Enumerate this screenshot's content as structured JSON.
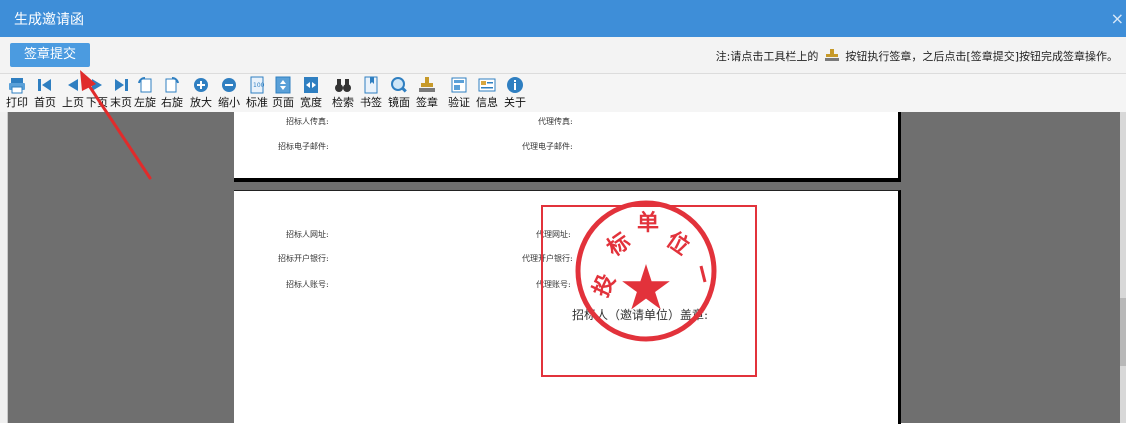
{
  "window": {
    "title": "生成邀请函",
    "close_glyph": "×"
  },
  "actionbar": {
    "sign_submit_label": "签章提交",
    "notice_prefix": "注:请点击工具栏上的",
    "notice_suffix": "按钮执行签章，之后点击[签章提交]按钮完成签章操作。"
  },
  "toolbar": {
    "items": [
      {
        "label": "打印",
        "icon": "printer-icon"
      },
      {
        "label": "首页",
        "icon": "first-page-icon"
      },
      {
        "label": "上页",
        "icon": "prev-page-icon"
      },
      {
        "label": "下页",
        "icon": "next-page-icon"
      },
      {
        "label": "末页",
        "icon": "last-page-icon"
      },
      {
        "label": "左旋",
        "icon": "rotate-left-icon"
      },
      {
        "label": "右旋",
        "icon": "rotate-right-icon"
      },
      {
        "label": "放大",
        "icon": "zoom-in-icon"
      },
      {
        "label": "缩小",
        "icon": "zoom-out-icon"
      },
      {
        "label": "标准",
        "icon": "actual-size-icon"
      },
      {
        "label": "页面",
        "icon": "fit-page-icon"
      },
      {
        "label": "宽度",
        "icon": "fit-width-icon"
      },
      {
        "label": "检索",
        "icon": "search-binoculars-icon"
      },
      {
        "label": "书签",
        "icon": "bookmark-icon"
      },
      {
        "label": "镜面",
        "icon": "magnifier-icon"
      },
      {
        "label": "签章",
        "icon": "stamp-icon"
      },
      {
        "label": "验证",
        "icon": "verify-icon"
      },
      {
        "label": "信息",
        "icon": "info-card-icon"
      },
      {
        "label": "关于",
        "icon": "about-icon"
      }
    ]
  },
  "document": {
    "page1": {
      "tenderer_fax": "招标人传真:",
      "agent_fax": "代理传真:",
      "tenderer_email": "招标电子邮件:",
      "agent_email": "代理电子邮件:"
    },
    "page2": {
      "tenderer_website": "招标人网址:",
      "agent_website": "代理网址:",
      "tenderer_bank": "招标开户银行:",
      "agent_bank": "代理开户银行:",
      "tenderer_account": "招标人账号:",
      "agent_account": "代理账号:",
      "seal_caption": "招标人（邀请单位）盖章:"
    },
    "stamp": {
      "text_chars": [
        "投",
        "标",
        "单",
        "位"
      ],
      "color": "#e2323b"
    }
  },
  "colors": {
    "titlebar": "#3e8ed8",
    "button": "#4b9be0",
    "viewer_bg": "#6f6f6f",
    "annotation_arrow": "#e02b2b"
  }
}
